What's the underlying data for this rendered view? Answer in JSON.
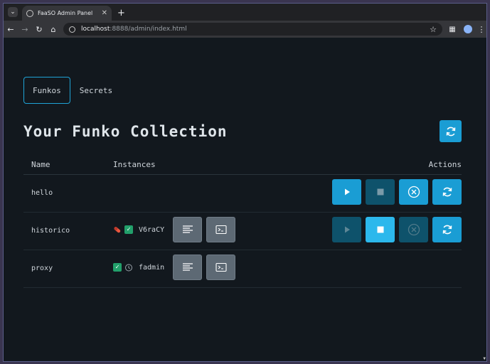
{
  "browser": {
    "tab_title": "FaaSO Admin Panel",
    "url_host": "localhost",
    "url_path": ":8888/admin/index.html"
  },
  "nav": {
    "tabs": [
      {
        "label": "Funkos",
        "active": true
      },
      {
        "label": "Secrets",
        "active": false
      }
    ]
  },
  "page": {
    "title": "Your Funko Collection"
  },
  "table": {
    "headers": {
      "name": "Name",
      "instances": "Instances",
      "actions": "Actions"
    },
    "rows": [
      {
        "name": "hello",
        "instances": []
      },
      {
        "name": "historico",
        "instances": [
          {
            "id": "V6raCY",
            "status_icon": "pill-icon",
            "check": true
          }
        ]
      },
      {
        "name": "proxy",
        "instances": [
          {
            "id": "fadmin",
            "status_icon": "alarm-icon",
            "check": true
          }
        ]
      }
    ]
  },
  "colors": {
    "accent": "#1a9dd4",
    "accent_dim": "#0e526b",
    "accent_bright": "#2cb8ec",
    "grey_button": "#5d6974",
    "background": "#12181e",
    "check": "#22a06b"
  }
}
